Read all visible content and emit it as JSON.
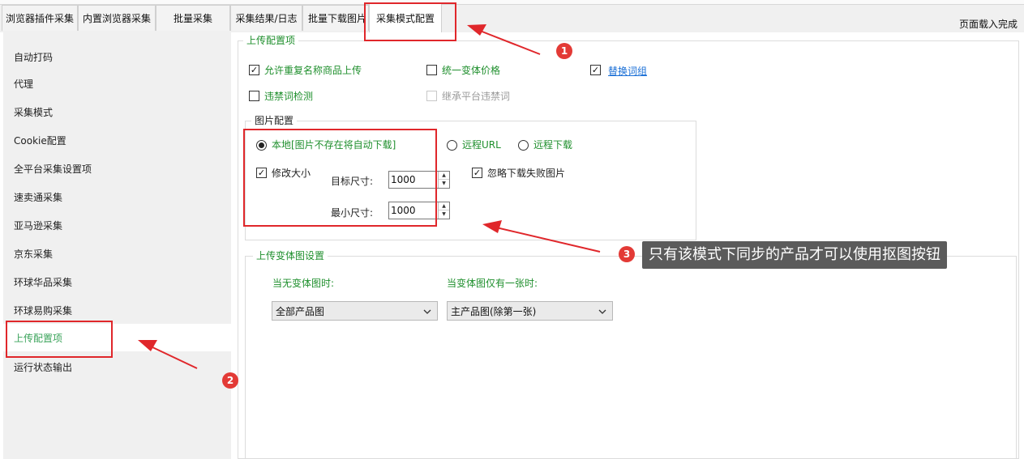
{
  "tabs": [
    {
      "label": "浏览器插件采集"
    },
    {
      "label": "内置浏览器采集"
    },
    {
      "label": "批量采集"
    },
    {
      "label": "采集结果/日志"
    },
    {
      "label": "批量下载图片"
    },
    {
      "label": "采集模式配置"
    }
  ],
  "status": "页面载入完成",
  "sidebar": {
    "items": [
      {
        "label": "自动打码"
      },
      {
        "label": "代理"
      },
      {
        "label": "采集模式"
      },
      {
        "label": "Cookie配置"
      },
      {
        "label": "全平台采集设置项"
      },
      {
        "label": "速卖通采集"
      },
      {
        "label": "亚马逊采集"
      },
      {
        "label": "京东采集"
      },
      {
        "label": "环球华品采集"
      },
      {
        "label": "环球易购采集"
      },
      {
        "label": "上传配置项"
      },
      {
        "label": "运行状态输出"
      }
    ]
  },
  "upload_config": {
    "title": "上传配置项",
    "allow_duplicate": {
      "label": "允许重复名称商品上传",
      "checked": true
    },
    "unify_variant_price": {
      "label": "统一变体价格",
      "checked": false
    },
    "replace_wordgroup": {
      "label": "替换词组",
      "checked": true
    },
    "banned_word_check": {
      "label": "违禁词检测",
      "checked": false
    },
    "inherit_banned": {
      "label": "继承平台违禁词",
      "checked": false
    }
  },
  "image_config": {
    "title": "图片配置",
    "local": {
      "label": "本地[图片不存在将自动下载]",
      "selected": true
    },
    "remote_url": {
      "label": "远程URL",
      "selected": false
    },
    "remote_download": {
      "label": "远程下载",
      "selected": false
    },
    "resize": {
      "label": "修改大小",
      "checked": true
    },
    "ignore_failed": {
      "label": "忽略下载失败图片",
      "checked": true
    },
    "target_size": {
      "label": "目标尺寸:",
      "value": "1000"
    },
    "min_size": {
      "label": "最小尺寸:",
      "value": "1000"
    }
  },
  "variant_image": {
    "title": "上传变体图设置",
    "no_variant": {
      "label": "当无变体图时:",
      "selected": "全部产品图"
    },
    "one_variant": {
      "label": "当变体图仅有一张时:",
      "selected": "主产品图(除第一张)"
    }
  },
  "annotations": {
    "badge1": "1",
    "badge2": "2",
    "badge3": "3",
    "tooltip": "只有该模式下同步的产品才可以使用抠图按钮",
    "color": "#e0272b"
  },
  "check_mark": "☑",
  "radio_dot": "●"
}
